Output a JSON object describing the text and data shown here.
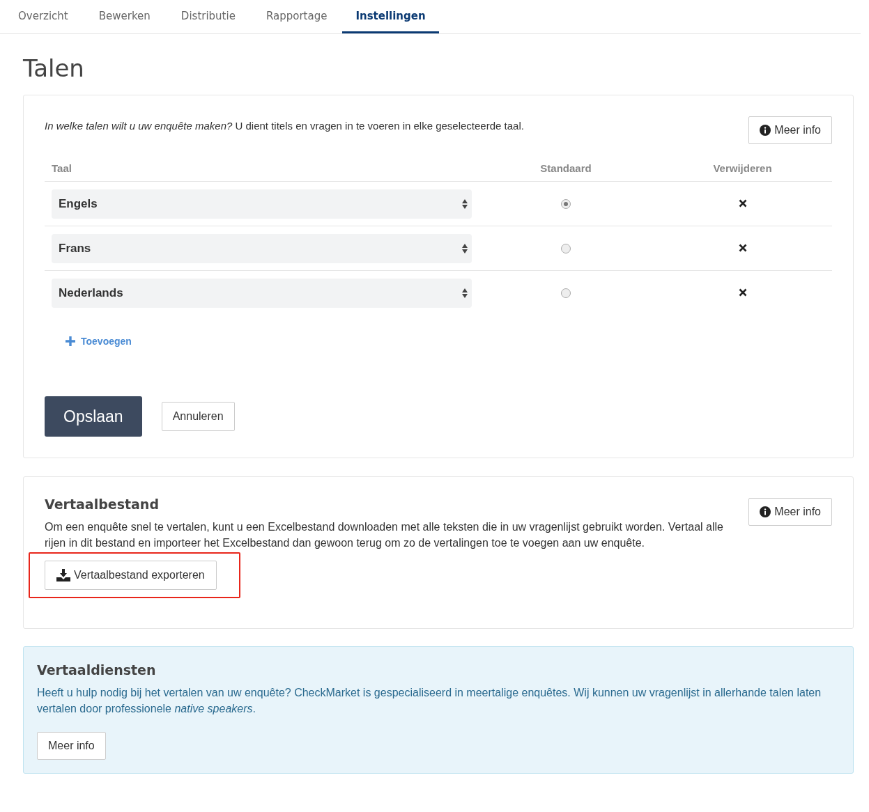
{
  "tabs": [
    {
      "label": "Overzicht",
      "selected": false
    },
    {
      "label": "Bewerken",
      "selected": false
    },
    {
      "label": "Distributie",
      "selected": false
    },
    {
      "label": "Rapportage",
      "selected": false
    },
    {
      "label": "Instellingen",
      "selected": true
    }
  ],
  "page_title": "Talen",
  "languages_panel": {
    "intro": "*In welke talen wilt u uw enquête maken?*  U dient titels en vragen in te voeren in elke geselecteerde taal.",
    "info_button": "Meer info",
    "columns": [
      "Taal",
      "Standaard",
      "Verwijderen"
    ],
    "rows": [
      {
        "language": "Engels",
        "selected": true
      },
      {
        "language": "Frans",
        "selected": false
      },
      {
        "language": "Nederlands",
        "selected": false
      }
    ],
    "add_link": "Toevoegen",
    "save_button": "Opslaan",
    "cancel_button": "Annuleren"
  },
  "file_panel": {
    "title": "Vertaalbestand",
    "info_button": "Meer info",
    "text": "Om een enquête snel te vertalen, kunt u een Excelbestand downloaden met alle teksten die in uw vragenlijst gebruikt worden. Vertaal alle rijen in dit bestand en importeer het Excelbestand dan gewoon terug om zo de vertalingen toe te voegen aan uw enquête.",
    "export_button": {
      "label": "Vertaalbestand exporteren",
      "highlighted": true
    }
  },
  "services_panel": {
    "title": "Vertaaldiensten",
    "text": "Heeft u hulp nodig bij het vertalen van uw enquête? CheckMarket is gespecialiseerd in meertalige enquêtes. Wij kunnen uw vragenlijst in allerhande talen laten vertalen door professionele *native speakers*.",
    "info_button": "Meer info"
  }
}
